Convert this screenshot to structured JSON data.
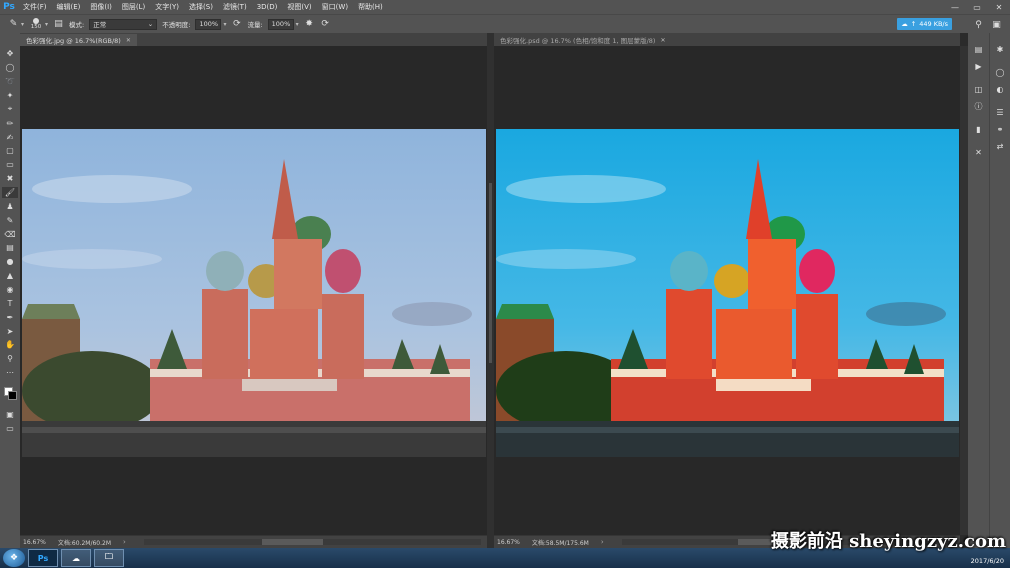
{
  "app": {
    "logo": "Ps"
  },
  "menubar": {
    "items": [
      "文件(F)",
      "编辑(E)",
      "图像(I)",
      "图层(L)",
      "文字(Y)",
      "选择(S)",
      "滤镜(T)",
      "3D(D)",
      "视图(V)",
      "窗口(W)",
      "帮助(H)"
    ],
    "window_controls": [
      "minimize-icon",
      "restore-icon",
      "close-icon"
    ]
  },
  "options": {
    "brush_size": "150",
    "mode_label": "模式:",
    "mode_value": "正常",
    "opacity_label": "不透明度:",
    "opacity_value": "100%",
    "flow_label": "流量:",
    "flow_value": "100%",
    "speed": "449 KB/s"
  },
  "documents": [
    {
      "tab_title": "色彩强化.jpg @ 16.7%(RGB/8)",
      "zoom": "16.67%",
      "doc_size": "文档:60.2M/60.2M",
      "active": true
    },
    {
      "tab_title": "色彩强化.psd @ 16.7% (色相/饱和度 1, 图层蒙版/8)",
      "zoom": "16.67%",
      "doc_size": "文档:58.5M/175.6M",
      "active": false
    }
  ],
  "taskbar": {
    "apps": [
      "Ps",
      "baidu-netdisk-icon",
      "file-explorer-icon"
    ],
    "date": "2017/6/20"
  },
  "watermark": "摄影前沿 sheyingzyz.com",
  "colors": {
    "ui_bg": "#535353",
    "canvas_bg": "#282828",
    "accent": "#31a8ff",
    "speed_badge": "#3aa0e0"
  }
}
